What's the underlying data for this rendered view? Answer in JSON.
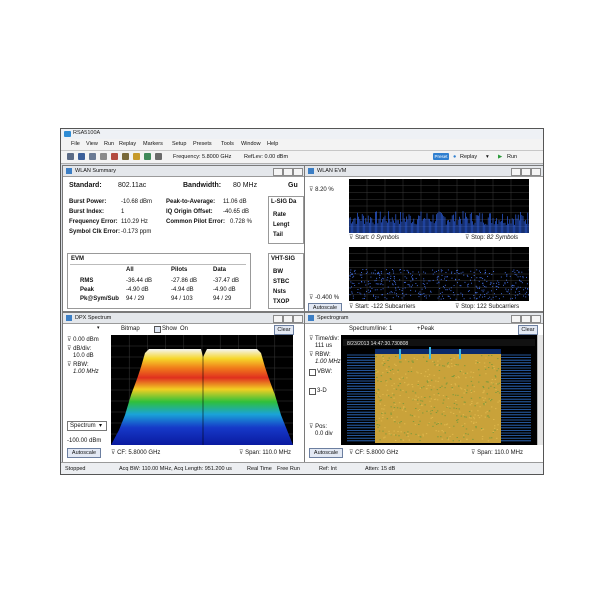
{
  "app": {
    "title": "RSA5100A"
  },
  "menu": [
    "File",
    "View",
    "Run",
    "Replay",
    "Markers",
    "Setup",
    "Presets",
    "Tools",
    "Window",
    "Help"
  ],
  "toolbar": {
    "frequency": "Frequency: 5.8000 GHz",
    "reflev": "RefLev: 0.00 dBm",
    "preset": "Preset",
    "replay": "Replay",
    "run": "Run"
  },
  "summary": {
    "title": "WLAN Summary",
    "standard_label": "Standard:",
    "standard": "802.11ac",
    "bandwidth_label": "Bandwidth:",
    "bandwidth": "80 MHz",
    "gi_label": "Gu",
    "left_rows": [
      {
        "label": "Burst Power:",
        "value": "-10.68 dBm"
      },
      {
        "label": "Burst Index:",
        "value": "1"
      },
      {
        "label": "Frequency Error:",
        "value": "110.29 Hz"
      },
      {
        "label": "Symbol Clk Error:",
        "value": "-0.173 ppm"
      }
    ],
    "mid_rows": [
      {
        "label": "Peak-to-Average:",
        "value": "11.06 dB"
      },
      {
        "label": "IQ Origin Offset:",
        "value": "-40.65 dB"
      },
      {
        "label": "Common Pilot Error:",
        "value": "0.728 %"
      }
    ],
    "lsig": {
      "title": "L-SIG Da",
      "rows": [
        "Rate",
        "Lengt",
        "Tail"
      ]
    },
    "evm": {
      "title": "EVM",
      "columns": [
        "All",
        "Pilots",
        "Data"
      ],
      "rows": [
        {
          "label": "RMS",
          "values": [
            "-36.44 dB",
            "-27.86 dB",
            "-37.47 dB"
          ]
        },
        {
          "label": "Peak",
          "values": [
            "-4.90 dB",
            "-4.94 dB",
            "-4.90 dB"
          ]
        },
        {
          "label": "Pk@Sym/Sub",
          "values": [
            "94 / 29",
            "94 / 103",
            "94 / 29"
          ]
        }
      ]
    },
    "vht": {
      "title": "VHT-SIG",
      "rows": [
        "BW",
        "STBC",
        "Nsts",
        "TXOP"
      ]
    }
  },
  "evm_panel": {
    "title": "WLAN EVM",
    "y_top": "8.20 %",
    "y_bottom": "-0.400 %",
    "start_top": "Start:",
    "start_top_val": "0 Symbols",
    "stop_top": "Stop:",
    "stop_top_val": "82 Symbols",
    "start_bot": "Start: -122 Subcarriers",
    "stop_bot": "Stop: 122 Subcarriers",
    "autoscale": "Autoscale"
  },
  "dpx": {
    "title": "DPX Spectrum",
    "bitmap": "Bitmap",
    "show": "Show",
    "on": "On",
    "clear": "Clear",
    "ref": "0.00 dBm",
    "div_label": "dB/div:",
    "div": "10.0 dB",
    "rbw_label": "RBW:",
    "rbw": "1.00 MHz",
    "spectrum_select": "Spectrum",
    "bottom_ref": "-100.00 dBm",
    "autoscale": "Autoscale",
    "cf": "CF: 5.8000 GHz",
    "span": "Span: 110.0 MHz"
  },
  "spectrogram": {
    "title": "Spectrogram",
    "spectrum_line": "Spectrum/line: 1",
    "peak": "+Peak",
    "clear": "Clear",
    "time_div_label": "Time/div:",
    "time_div": "111 us",
    "rbw_label": "RBW:",
    "rbw": "1.00 MHz",
    "vbw": "VBW:",
    "three_d": "3-D",
    "pos_label": "Pos:",
    "pos": "0.0 div",
    "timestamp": "8/23/2013 14:47:30.730808",
    "autoscale": "Autoscale",
    "cf": "CF: 5.8000 GHz",
    "span": "Span: 110.0 MHz"
  },
  "status": {
    "state": "Stopped",
    "acq": "Acq BW: 110.00 MHz, Acq Length: 951.200 us",
    "realtime": "Real Time",
    "freerun": "Free Run",
    "ref": "Ref: Int",
    "atten": "Atten: 15 dB"
  },
  "colors": {
    "accent": "#2f7fd0",
    "plot_bg": "#000000",
    "spectrogram": "#c9a23a"
  }
}
